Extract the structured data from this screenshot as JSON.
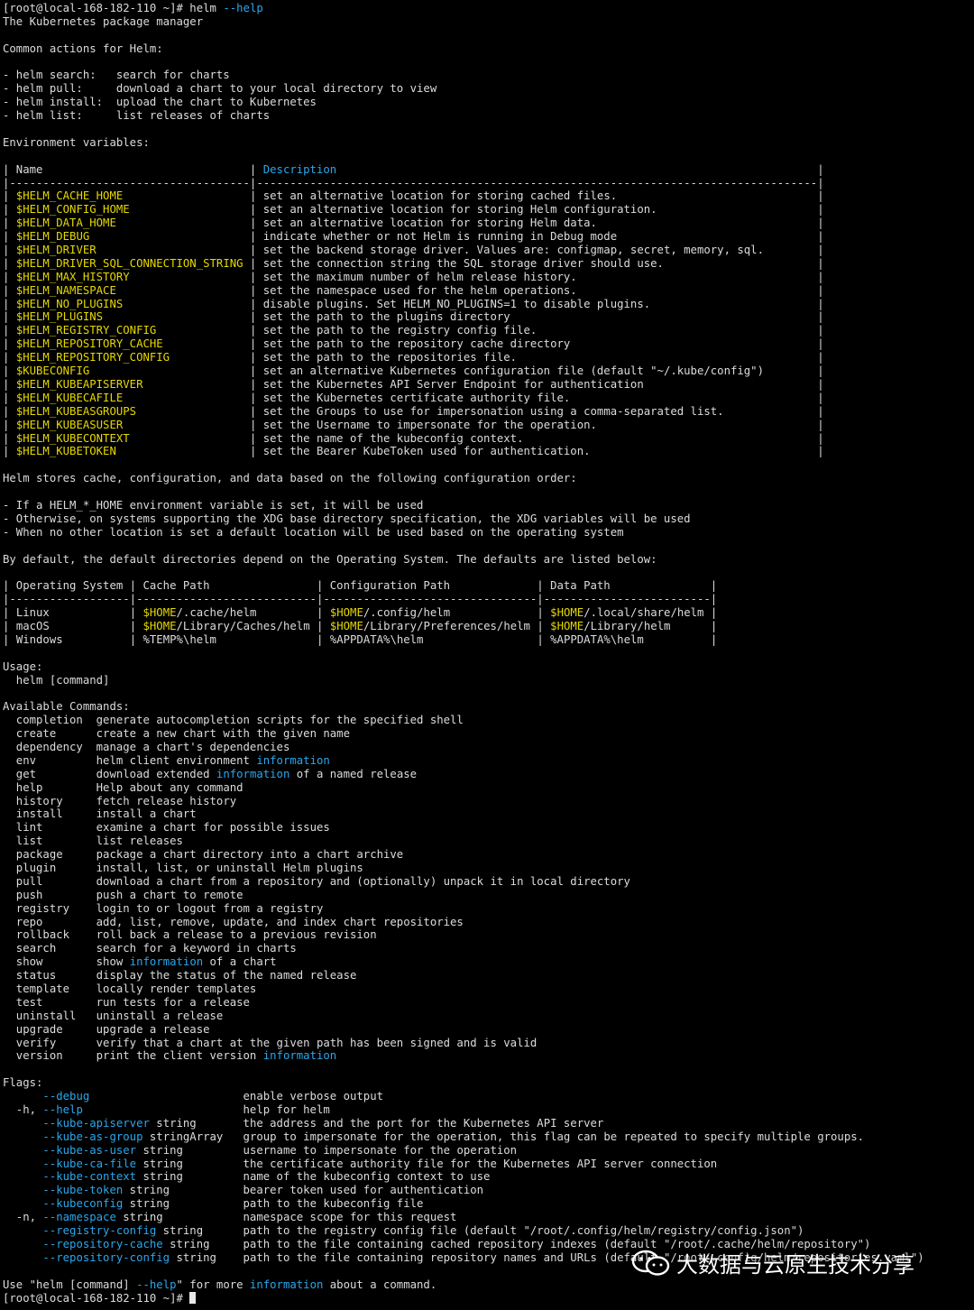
{
  "colors": {
    "background": "#000000",
    "text": "#dcdcdc",
    "yellow": "#e6d800",
    "blue": "#2aa7ec"
  },
  "prompt": {
    "text": "[root@local-168-182-110 ~]# ",
    "command": "helm ",
    "flag": "--help"
  },
  "title": "The Kubernetes package manager",
  "common_header": "Common actions for Helm:",
  "common_actions": [
    {
      "cmd": "helm search:",
      "desc": "search for charts"
    },
    {
      "cmd": "helm pull:",
      "desc": "download a chart to your local directory to view"
    },
    {
      "cmd": "helm install:",
      "desc": "upload the chart to Kubernetes"
    },
    {
      "cmd": "helm list:",
      "desc": "list releases of charts"
    }
  ],
  "env_header": "Environment variables:",
  "env_table": {
    "col_name": "Name",
    "col_desc": "Description",
    "rows": [
      [
        "$HELM_CACHE_HOME",
        "set an alternative location for storing cached files."
      ],
      [
        "$HELM_CONFIG_HOME",
        "set an alternative location for storing Helm configuration."
      ],
      [
        "$HELM_DATA_HOME",
        "set an alternative location for storing Helm data."
      ],
      [
        "$HELM_DEBUG",
        "indicate whether or not Helm is running in Debug mode"
      ],
      [
        "$HELM_DRIVER",
        "set the backend storage driver. Values are: configmap, secret, memory, sql."
      ],
      [
        "$HELM_DRIVER_SQL_CONNECTION_STRING",
        "set the connection string the SQL storage driver should use."
      ],
      [
        "$HELM_MAX_HISTORY",
        "set the maximum number of helm release history."
      ],
      [
        "$HELM_NAMESPACE",
        "set the namespace used for the helm operations."
      ],
      [
        "$HELM_NO_PLUGINS",
        "disable plugins. Set HELM_NO_PLUGINS=1 to disable plugins."
      ],
      [
        "$HELM_PLUGINS",
        "set the path to the plugins directory"
      ],
      [
        "$HELM_REGISTRY_CONFIG",
        "set the path to the registry config file."
      ],
      [
        "$HELM_REPOSITORY_CACHE",
        "set the path to the repository cache directory"
      ],
      [
        "$HELM_REPOSITORY_CONFIG",
        "set the path to the repositories file."
      ],
      [
        "$KUBECONFIG",
        "set an alternative Kubernetes configuration file (default \"~/.kube/config\")"
      ],
      [
        "$HELM_KUBEAPISERVER",
        "set the Kubernetes API Server Endpoint for authentication"
      ],
      [
        "$HELM_KUBECAFILE",
        "set the Kubernetes certificate authority file."
      ],
      [
        "$HELM_KUBEASGROUPS",
        "set the Groups to use for impersonation using a comma-separated list."
      ],
      [
        "$HELM_KUBEASUSER",
        "set the Username to impersonate for the operation."
      ],
      [
        "$HELM_KUBECONTEXT",
        "set the name of the kubeconfig context."
      ],
      [
        "$HELM_KUBETOKEN",
        "set the Bearer KubeToken used for authentication."
      ]
    ]
  },
  "storage_text": "Helm stores cache, configuration, and data based on the following configuration order:",
  "storage_bullets": [
    "- If a HELM_*_HOME environment variable is set, it will be used",
    "- Otherwise, on systems supporting the XDG base directory specification, the XDG variables will be used",
    "- When no other location is set a default location will be used based on the operating system"
  ],
  "defaults_text": "By default, the default directories depend on the Operating System. The defaults are listed below:",
  "os_table": {
    "headers": [
      "Operating System",
      "Cache Path",
      "Configuration Path",
      "Data Path"
    ],
    "rows": [
      [
        {
          "t": "Linux"
        },
        {
          "v": "$HOME",
          "t": "/.cache/helm"
        },
        {
          "v": "$HOME",
          "t": "/.config/helm"
        },
        {
          "v": "$HOME",
          "t": "/.local/share/helm"
        }
      ],
      [
        {
          "t": "macOS"
        },
        {
          "v": "$HOME",
          "t": "/Library/Caches/helm"
        },
        {
          "v": "$HOME",
          "t": "/Library/Preferences/helm"
        },
        {
          "v": "$HOME",
          "t": "/Library/helm"
        }
      ],
      [
        {
          "t": "Windows"
        },
        {
          "t": "%TEMP%\\helm"
        },
        {
          "t": "%APPDATA%\\helm"
        },
        {
          "t": "%APPDATA%\\helm"
        }
      ]
    ]
  },
  "usage_header": "Usage:",
  "usage_cmd": "  helm [command]",
  "commands_header": "Available Commands:",
  "commands": [
    {
      "name": "completion",
      "desc": "generate autocompletion scripts for the specified shell"
    },
    {
      "name": "create",
      "desc": "create a new chart with the given name"
    },
    {
      "name": "dependency",
      "desc": "manage a chart's dependencies"
    },
    {
      "name": "env",
      "desc": "helm client environment ",
      "hl": "information"
    },
    {
      "name": "get",
      "desc": "download extended ",
      "hl": "information",
      "post": " of a named release"
    },
    {
      "name": "help",
      "desc": "Help about any command"
    },
    {
      "name": "history",
      "desc": "fetch release history"
    },
    {
      "name": "install",
      "desc": "install a chart"
    },
    {
      "name": "lint",
      "desc": "examine a chart for possible issues"
    },
    {
      "name": "list",
      "desc": "list releases"
    },
    {
      "name": "package",
      "desc": "package a chart directory into a chart archive"
    },
    {
      "name": "plugin",
      "desc": "install, list, or uninstall Helm plugins"
    },
    {
      "name": "pull",
      "desc": "download a chart from a repository and (optionally) unpack it in local directory"
    },
    {
      "name": "push",
      "desc": "push a chart to remote"
    },
    {
      "name": "registry",
      "desc": "login to or logout from a registry"
    },
    {
      "name": "repo",
      "desc": "add, list, remove, update, and index chart repositories"
    },
    {
      "name": "rollback",
      "desc": "roll back a release to a previous revision"
    },
    {
      "name": "search",
      "desc": "search for a keyword in charts"
    },
    {
      "name": "show",
      "desc": "show ",
      "hl": "information",
      "post": " of a chart"
    },
    {
      "name": "status",
      "desc": "display the status of the named release"
    },
    {
      "name": "template",
      "desc": "locally render templates"
    },
    {
      "name": "test",
      "desc": "run tests for a release"
    },
    {
      "name": "uninstall",
      "desc": "uninstall a release"
    },
    {
      "name": "upgrade",
      "desc": "upgrade a release"
    },
    {
      "name": "verify",
      "desc": "verify that a chart at the given path has been signed and is valid"
    },
    {
      "name": "version",
      "desc": "print the client version ",
      "hl": "information"
    }
  ],
  "flags_header": "Flags:",
  "flags": [
    {
      "short": "",
      "flag": "--debug",
      "arg": "",
      "desc": "enable verbose output"
    },
    {
      "short": "-h, ",
      "flag": "--help",
      "arg": "",
      "desc": "help for helm"
    },
    {
      "short": "",
      "flag": "--kube-apiserver",
      "arg": " string",
      "desc": "the address and the port for the Kubernetes API server"
    },
    {
      "short": "",
      "flag": "--kube-as-group",
      "arg": " stringArray",
      "desc": "group to impersonate for the operation, this flag can be repeated to specify multiple groups."
    },
    {
      "short": "",
      "flag": "--kube-as-user",
      "arg": " string",
      "desc": "username to impersonate for the operation"
    },
    {
      "short": "",
      "flag": "--kube-ca-file",
      "arg": " string",
      "desc": "the certificate authority file for the Kubernetes API server connection"
    },
    {
      "short": "",
      "flag": "--kube-context",
      "arg": " string",
      "desc": "name of the kubeconfig context to use"
    },
    {
      "short": "",
      "flag": "--kube-token",
      "arg": " string",
      "desc": "bearer token used for authentication"
    },
    {
      "short": "",
      "flag": "--kubeconfig",
      "arg": " string",
      "desc": "path to the kubeconfig file"
    },
    {
      "short": "-n, ",
      "flag": "--namespace",
      "arg": " string",
      "desc": "namespace scope for this request"
    },
    {
      "short": "",
      "flag": "--registry-config",
      "arg": " string",
      "desc": "path to the registry config file (default \"/root/.config/helm/registry/config.json\")"
    },
    {
      "short": "",
      "flag": "--repository-cache",
      "arg": " string",
      "desc": "path to the file containing cached repository indexes (default \"/root/.cache/helm/repository\")"
    },
    {
      "short": "",
      "flag": "--repository-config",
      "arg": " string",
      "desc": "path to the file containing repository names and URLs (default \"/root/.config/helm/repositories.yaml\")"
    }
  ],
  "footer": {
    "pre": "Use \"helm [command] ",
    "flag": "--help",
    "mid": "\" for more ",
    "hl": "information",
    "post": " about a command."
  },
  "final_prompt": "[root@local-168-182-110 ~]# ",
  "watermark": {
    "text": "大数据与云原生技术分享",
    "icon": "wechat-icon"
  }
}
